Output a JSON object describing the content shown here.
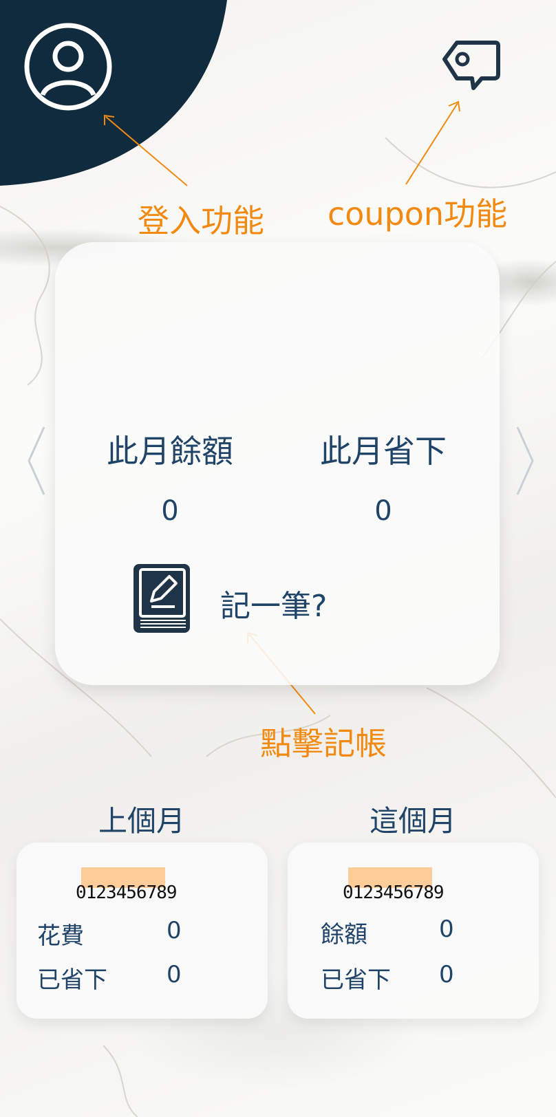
{
  "header": {
    "avatar_icon": "user-circle-icon",
    "coupon_icon": "coupon-tag-icon"
  },
  "annotations": {
    "login": "登入功能",
    "coupon": "coupon功能",
    "record": "點擊記帳"
  },
  "summary": {
    "balance_label": "此月餘額",
    "balance_value": "0",
    "saved_label": "此月省下",
    "saved_value": "0",
    "record_label": "記一筆?",
    "record_icon": "notebook-edit-icon"
  },
  "last_month": {
    "title": "上個月",
    "garbled": "0123456789",
    "rows": [
      {
        "label": "花費",
        "value": "0"
      },
      {
        "label": "已省下",
        "value": "0"
      }
    ]
  },
  "this_month": {
    "title": "這個月",
    "garbled": "0123456789",
    "rows": [
      {
        "label": "餘額",
        "value": "0"
      },
      {
        "label": "已省下",
        "value": "0"
      }
    ]
  },
  "colors": {
    "corner": "#0f2b3d",
    "text": "#1f4468",
    "annotation": "#f28a12",
    "redaction": "#fccc99"
  }
}
